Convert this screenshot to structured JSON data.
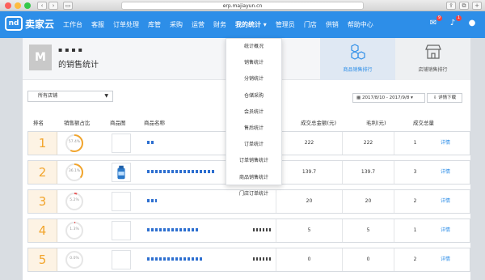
{
  "browser": {
    "url": "erp.majiayun.cn"
  },
  "nav": {
    "logo_mark": "nd",
    "logo_text": "卖家云",
    "menu": [
      "工作台",
      "客服",
      "订单处理",
      "库管",
      "采购",
      "运营",
      "财务",
      "我的统计",
      "管理员",
      "门店",
      "供销",
      "帮助中心"
    ],
    "active_index": 7,
    "msg_badge": "9",
    "bell_badge": "1"
  },
  "header": {
    "user_name": "▪ ▪ ▪ ▪",
    "avatar_letter": "M",
    "page_title": "的销售统计",
    "tabs": [
      {
        "label": "商品销售排行",
        "active": true
      },
      {
        "label": "店铺销售排行",
        "active": false
      }
    ]
  },
  "filters": {
    "store_select": "所有店铺",
    "date_range": "2017/8/10 - 2017/9/8",
    "download_label": "详情下载"
  },
  "table": {
    "columns": [
      "排名",
      "销售额占比",
      "商品图",
      "商品名称",
      "成交总金额(元)",
      "毛利(元)",
      "成交总量"
    ],
    "detail_label": "详情",
    "rows": [
      {
        "rank": "1",
        "pct": "57.4%",
        "pct_value": 0.574,
        "amount": "222",
        "profit": "222",
        "qty": "1",
        "has_img": false,
        "name_w": 10
      },
      {
        "rank": "2",
        "pct": "36.1%",
        "pct_value": 0.361,
        "amount": "139.7",
        "profit": "139.7",
        "qty": "3",
        "has_img": true,
        "name_w": 84
      },
      {
        "rank": "3",
        "pct": "5.2%",
        "pct_value": 0.052,
        "amount": "20",
        "profit": "20",
        "qty": "2",
        "has_img": false,
        "name_w": 12
      },
      {
        "rank": "4",
        "pct": "1.3%",
        "pct_value": 0.013,
        "amount": "5",
        "profit": "5",
        "qty": "1",
        "has_img": false,
        "name_w": 64
      },
      {
        "rank": "5",
        "pct": "0.0%",
        "pct_value": 0.0,
        "amount": "0",
        "profit": "0",
        "qty": "2",
        "has_img": false,
        "name_w": 70
      }
    ]
  },
  "dropdown": {
    "items": [
      "统计概况",
      "销售统计",
      "分销统计",
      "仓储采购",
      "会员统计",
      "售后统计",
      "订单统计",
      "订单销售统计",
      "商品销售统计",
      "门店订单统计"
    ]
  },
  "colors": {
    "brand": "#2d8ee8",
    "rank": "#f2a52c",
    "ring_fill": "#f2a52c",
    "ring_low": "#e85a5a"
  }
}
